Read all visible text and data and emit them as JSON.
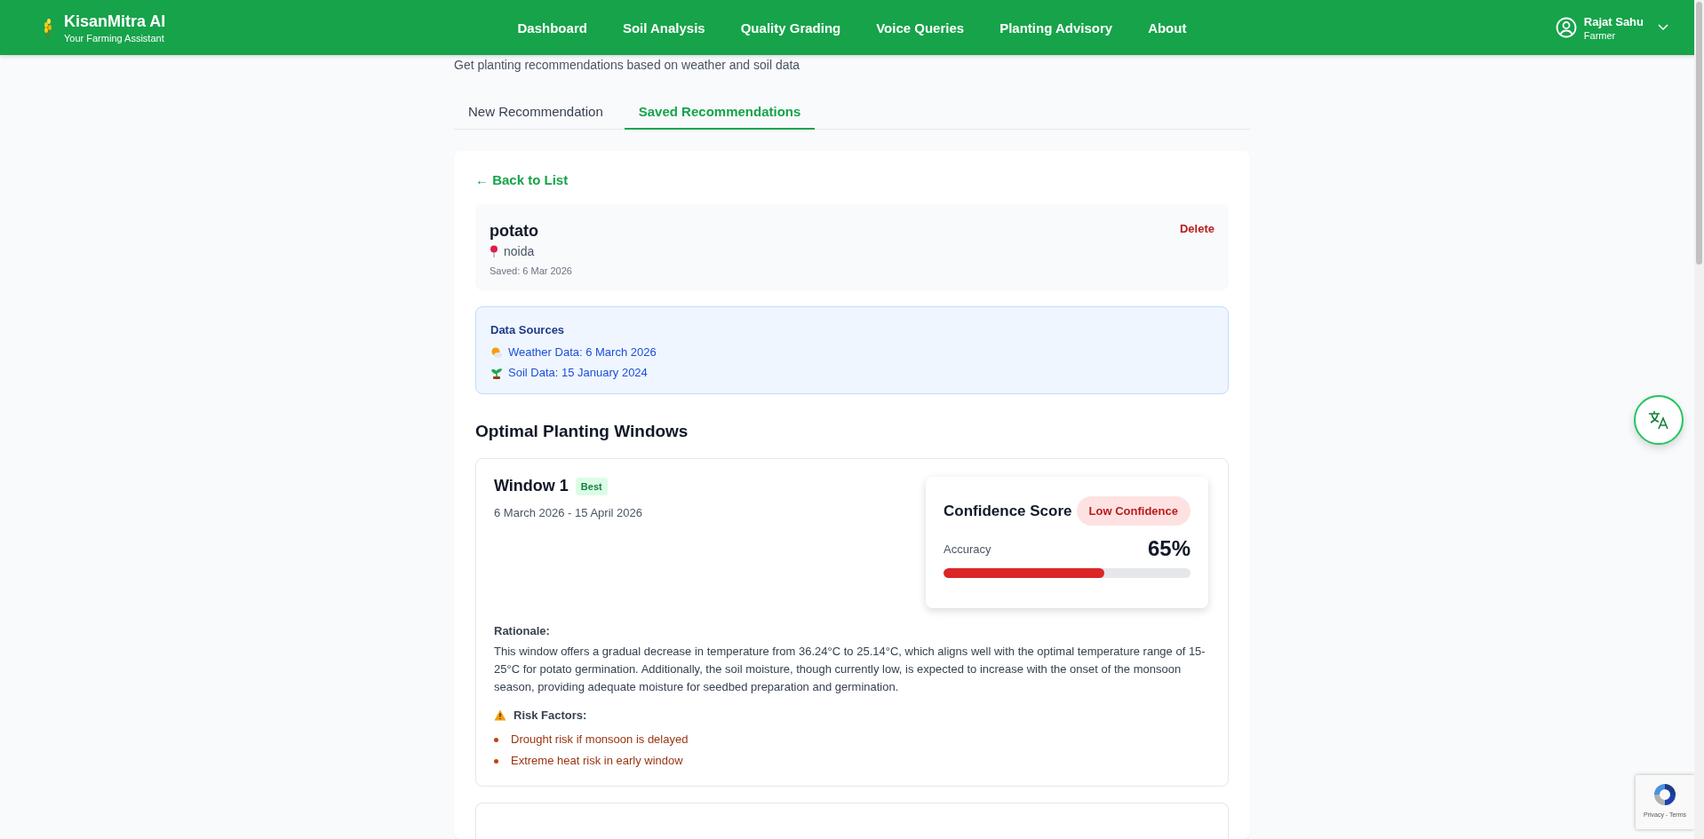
{
  "header": {
    "brand": "KisanMitra AI",
    "tagline": "Your Farming Assistant",
    "nav": [
      {
        "label": "Dashboard"
      },
      {
        "label": "Soil Analysis"
      },
      {
        "label": "Quality Grading"
      },
      {
        "label": "Voice Queries"
      },
      {
        "label": "Planting Advisory"
      },
      {
        "label": "About"
      }
    ],
    "user": {
      "name": "Rajat Sahu",
      "role": "Farmer"
    }
  },
  "subtitle": "Get planting recommendations based on weather and soil data",
  "tabs": [
    {
      "label": "New Recommendation",
      "selected": false
    },
    {
      "label": "Saved Recommendations",
      "selected": true
    }
  ],
  "detail": {
    "back_link": "← Back to List",
    "crop": "potato",
    "location": "noida",
    "saved": "Saved: 6 Mar 2026",
    "delete": "Delete",
    "data_sources": {
      "title": "Data Sources",
      "items": [
        {
          "kind": "weather",
          "text": "Weather Data: 6 March 2026"
        },
        {
          "kind": "soil",
          "text": "Soil Data: 15 January 2024"
        }
      ]
    },
    "windows_title": "Optimal Planting Windows",
    "windows": [
      {
        "title": "Window 1",
        "badge": "Best",
        "dates": "6 March 2026 - 15 April 2026",
        "confidence": {
          "title": "Confidence Score",
          "badge": "Low Confidence",
          "label": "Accuracy",
          "value": "65%",
          "level": 0.65
        },
        "rationale_title": "Rationale:",
        "rationale": "This window offers a gradual decrease in temperature from 36.24°C to 25.14°C, which aligns well with the optimal temperature range of 15-25°C for potato germination. Additionally, the soil moisture, though currently low, is expected to increase with the onset of the monsoon season, providing adequate moisture for seedbed preparation and germination.",
        "risks_title": "Risk Factors:",
        "risks": [
          "Drought risk if monsoon is delayed",
          "Extreme heat risk in early window"
        ]
      }
    ]
  },
  "recaptcha": {
    "links": "Privacy - Terms"
  }
}
